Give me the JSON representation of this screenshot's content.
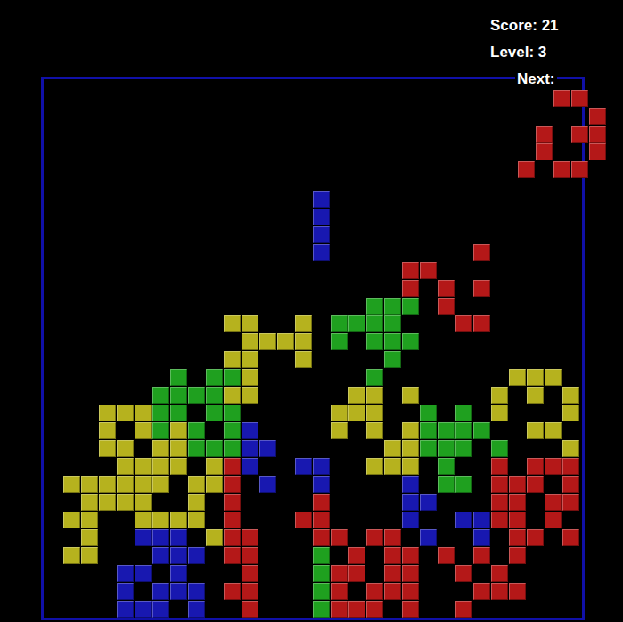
{
  "hud": {
    "score": "Score: 21",
    "level": "Level: 3"
  },
  "palette": {
    "Y": "#b6b21e",
    "G": "#1fa01f",
    "R": "#b41818",
    "B": "#1818b0"
  },
  "board": {
    "rows": [
      "..............................",
      "..............................",
      "..............................",
      "..............................",
      "..............................",
      "..............................",
      "..............................",
      "..............................",
      "..............................",
      "........................R.....",
      "....................RR........",
      "....................R.R.R.....",
      "..................GGG.R.......",
      "..........YY..Y.GGGG...RR.....",
      "...........YYYY.G.GGG.........",
      "..........YY..Y....G..........",
      ".......G.GGY......G.......YYY.",
      "......GGGGYY.....YY.Y....Y.Y.Y",
      "...YYYGG.GG.....YYY..G.G.Y...Y",
      "...Y.YGYG.GB....Y.Y.YGGGG..YY.",
      "...YY.YYGGGBB......YYGGG.G...Y",
      "....YYYY.YRB..BB..YYY.G..R.RRR",
      ".YYYYYY.YYR.B..B....B.GG.RRR.R",
      "..YYYY..Y.R....R....BB...RR.RR",
      ".YY..YYYY.R...RR....B..BBRR.R.",
      "..Y..BBB.YRR...RR.RR.B..B.RR.R",
      ".YY...BBB.RR...G.R.RR.R.R.R...",
      "....BB.B...R...GRR.RR..R.R....",
      "....B.BBB.RR...GR.RRR...RRR...",
      "....BBB.B..R...GRRR.R..R......"
    ]
  },
  "falling": {
    "kind": "I",
    "color": "#1818b0",
    "cells": [
      [
        15,
        6
      ],
      [
        15,
        7
      ],
      [
        15,
        8
      ],
      [
        15,
        9
      ]
    ]
  },
  "next": {
    "label": "Next:",
    "color": "#b41818",
    "cells": [
      [
        2,
        0
      ],
      [
        3,
        0
      ],
      [
        4,
        1
      ],
      [
        1,
        2
      ],
      [
        3,
        2
      ],
      [
        4,
        2
      ],
      [
        1,
        3
      ],
      [
        4,
        3
      ],
      [
        0,
        4
      ],
      [
        2,
        4
      ],
      [
        3,
        4
      ]
    ]
  }
}
